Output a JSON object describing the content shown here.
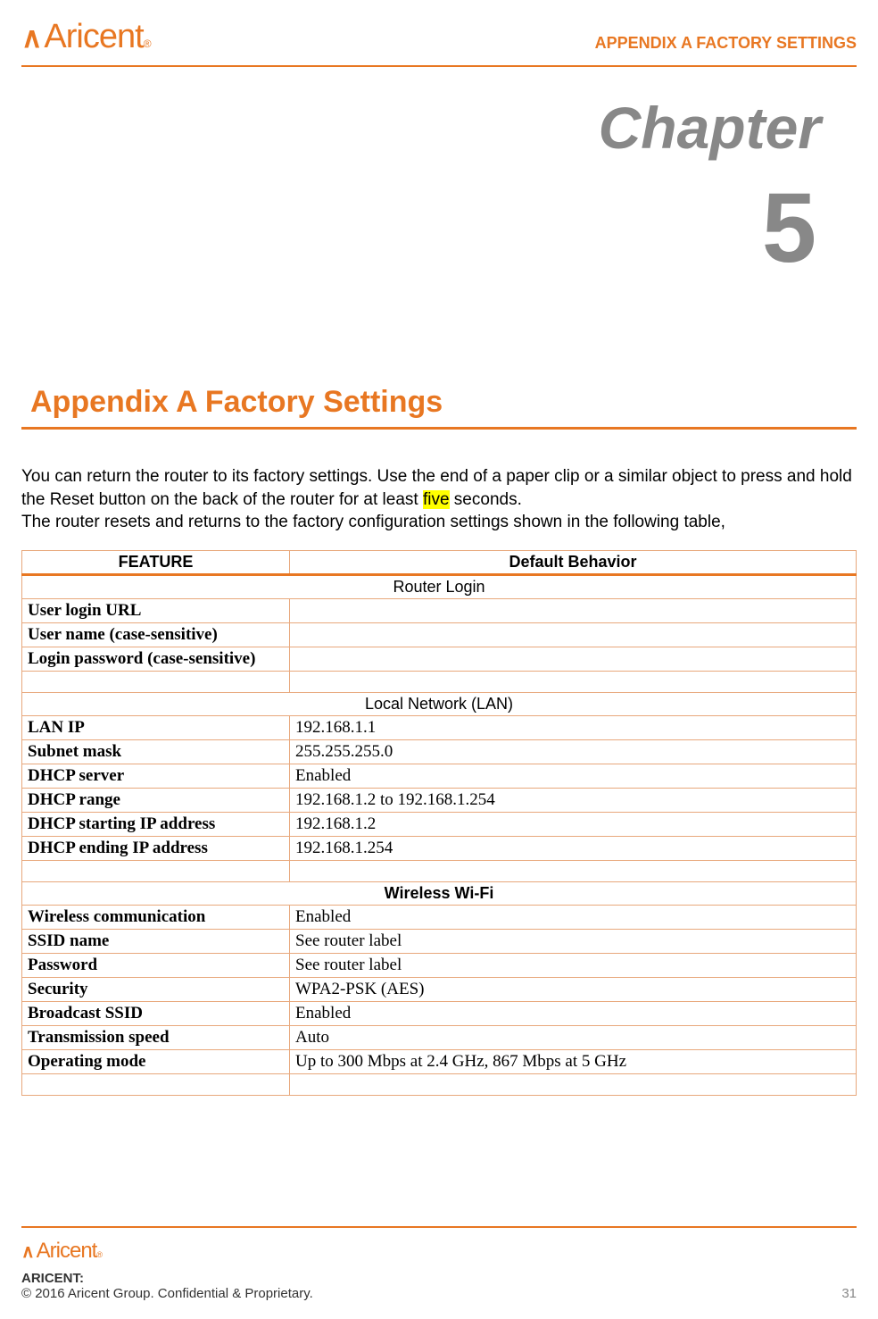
{
  "header": {
    "logo_text": "Aricent",
    "appendix_label": "APPENDIX A FACTORY SETTINGS"
  },
  "chapter": {
    "label": "Chapter",
    "number": "5"
  },
  "section": {
    "title": "Appendix A Factory Settings"
  },
  "body": {
    "p1a": "You can return the router to its factory settings. Use the end of a paper clip or a similar object to press and hold the Reset button on the back of the router for at least ",
    "p1_highlight": "five",
    "p1b": " seconds.",
    "p2": "The router resets and returns to the factory configuration settings shown in the following table,"
  },
  "table": {
    "col1": "FEATURE",
    "col2": "Default Behavior",
    "sect1": "Router Login",
    "r1f": "User login URL",
    "r1v": "",
    "r2f": "User name (case-sensitive)",
    "r2v": "",
    "r3f": "Login password (case-sensitive)",
    "r3v": "",
    "sect2": "Local Network (LAN)",
    "r4f": "LAN IP",
    "r4v": "192.168.1.1",
    "r5f": "Subnet mask",
    "r5v": "255.255.255.0",
    "r6f": "DHCP server",
    "r6v": "Enabled",
    "r7f": "DHCP range",
    "r7v": "192.168.1.2 to 192.168.1.254",
    "r8f": "DHCP starting IP address",
    "r8v": "192.168.1.2",
    "r9f": "DHCP ending IP address",
    "r9v": "192.168.1.254",
    "sect3": "Wireless Wi-Fi",
    "r10f": "Wireless communication",
    "r10v": "Enabled",
    "r11f": "SSID name",
    "r11v": "See router label",
    "r12f": "Password",
    "r12v": "See router label",
    "r13f": "Security",
    "r13v": "WPA2-PSK (AES)",
    "r14f": "Broadcast SSID",
    "r14v": "Enabled",
    "r15f": "Transmission speed",
    "r15v": "Auto",
    "r16f": "Operating mode",
    "r16v": "Up to 300 Mbps at 2.4 GHz, 867 Mbps at 5 GHz"
  },
  "footer": {
    "logo_text": "Aricent",
    "aricent_label": "ARICENT:",
    "copyright": "© 2016 Aricent Group. Confidential & Proprietary.",
    "page": "31"
  }
}
